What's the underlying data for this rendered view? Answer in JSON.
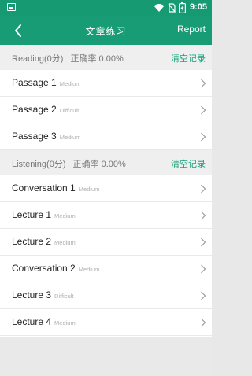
{
  "status_bar": {
    "time": "9:05",
    "icons": [
      "image-icon",
      "wifi-icon",
      "no-sim-icon",
      "battery-icon"
    ]
  },
  "app_bar": {
    "title": "文章练习",
    "report_label": "Report",
    "back_icon": "back-arrow-icon"
  },
  "sections": [
    {
      "header": {
        "label": "Reading(0分)",
        "accuracy": "正确率 0.00%",
        "clear_label": "清空记录"
      },
      "items": [
        {
          "title": "Passage 1",
          "level": "Medium"
        },
        {
          "title": "Passage 2",
          "level": "Difficult"
        },
        {
          "title": "Passage 3",
          "level": "Medium"
        }
      ]
    },
    {
      "header": {
        "label": "Listening(0分)",
        "accuracy": "正确率 0.00%",
        "clear_label": "清空记录"
      },
      "items": [
        {
          "title": "Conversation 1",
          "level": "Medium"
        },
        {
          "title": "Lecture 1",
          "level": "Medium"
        },
        {
          "title": "Lecture 2",
          "level": "Medium"
        },
        {
          "title": "Conversation 2",
          "level": "Medium"
        },
        {
          "title": "Lecture 3",
          "level": "Difficult"
        },
        {
          "title": "Lecture 4",
          "level": "Medium"
        }
      ]
    }
  ],
  "colors": {
    "primary": "#179c75",
    "accent_text": "#16a37b",
    "section_bg": "#efefef"
  }
}
